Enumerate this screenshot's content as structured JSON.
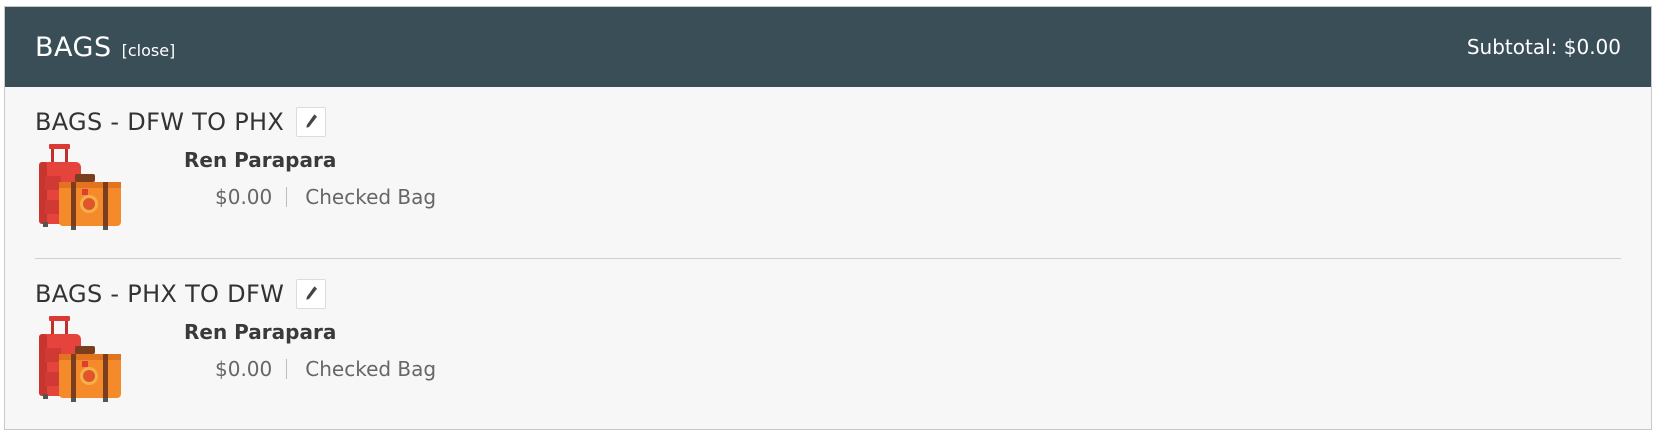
{
  "header": {
    "title": "BAGS",
    "close_label": "[close]",
    "subtotal": "Subtotal: $0.00",
    "background": "#3a4e57"
  },
  "segments": [
    {
      "title": "BAGS - DFW TO PHX",
      "edit_icon": "pencil-icon",
      "image": "luggage-illustration",
      "passenger": "Ren Parapara",
      "price": "$0.00",
      "bag_type": "Checked Bag"
    },
    {
      "title": "BAGS - PHX TO DFW",
      "edit_icon": "pencil-icon",
      "image": "luggage-illustration",
      "passenger": "Ren Parapara",
      "price": "$0.00",
      "bag_type": "Checked Bag"
    }
  ]
}
